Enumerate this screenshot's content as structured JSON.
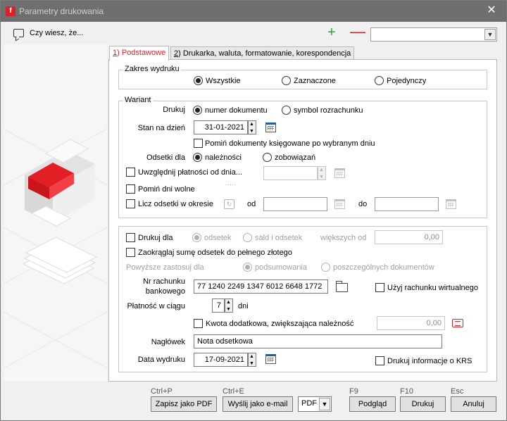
{
  "window": {
    "title": "Parametry drukowania",
    "close": "✕"
  },
  "toolbar": {
    "hint": "Czy wiesz, że...",
    "add": "+",
    "remove": "—",
    "combo_value": ""
  },
  "tabs": [
    {
      "key": "1",
      "label": ") Podstawowe"
    },
    {
      "key": "2",
      "label": ") Drukarka, waluta, formatowanie, korespondencja"
    }
  ],
  "zakres": {
    "title": "Zakres wydruku",
    "options": [
      "Wszystkie",
      "Zaznaczone",
      "Pojedynczy"
    ],
    "selected": "Wszystkie"
  },
  "wariant": {
    "title": "Wariant",
    "drukuj_label": "Drukuj",
    "drukuj_options": [
      "numer dokumentu",
      "symbol rozrachunku"
    ],
    "stan_label": "Stan na dzień",
    "stan_value": "31-01-2021",
    "pomin_ksiegowane": "Pomiń dokumenty księgowane po wybranym dniu",
    "odsetki_label": "Odsetki dla",
    "odsetki_options": [
      "należności",
      "zobowiązań"
    ],
    "uwzglednij": "Uwzględnij płatności od dnia...",
    "uwzglednij_value": "",
    "dots": ".....",
    "pomin_wolne": "Pomiń dni wolne",
    "licz_odsetki": "Licz odsetki w okresie",
    "od_label": "od",
    "do_label": "do",
    "od_value": "",
    "do_value": ""
  },
  "lower": {
    "drukuj_dla": "Drukuj dla",
    "drukuj_dla_options": [
      "odsetek",
      "sald i odsetek"
    ],
    "wiekszych_label": "większych od",
    "wiekszych_value": "0,00",
    "zaokraglaj": "Zaokrąglaj sumę odsetek do pełnego złotego",
    "powyzsze_label": "Powyższe zastosuj dla",
    "powyzsze_options": [
      "podsumowania",
      "poszczególnych dokumentów"
    ],
    "nr_rachunku_line1": "Nr rachunku",
    "nr_rachunku_line2": "bankowego",
    "nr_rachunku_value": "77 1240 2249 1347 6012 6648 1772",
    "uzyj_wirtualnego": "Użyj rachunku wirtualnego",
    "platnosc_label": "Płatność w ciągu",
    "platnosc_value": "7",
    "platnosc_unit": "dni",
    "kwota_dodatkowa": "Kwota dodatkowa, zwiększająca należność",
    "kwota_value": "0,00",
    "naglowek_label": "Nagłówek",
    "naglowek_value": "Nota odsetkowa",
    "data_label": "Data wydruku",
    "data_value": "17-09-2021",
    "krs": "Drukuj informacje o KRS"
  },
  "footer": {
    "pdf_shortcut": "Ctrl+P",
    "pdf_button": "Zapisz jako PDF",
    "email_shortcut": "Ctrl+E",
    "email_button": "Wyślij jako e-mail",
    "format_value": "PDF",
    "preview_shortcut": "F9",
    "preview_button": "Podgląd",
    "print_shortcut": "F10",
    "print_button": "Drukuj",
    "cancel_shortcut": "Esc",
    "cancel_button": "Anuluj"
  },
  "colors": {
    "accent": "#d6222a",
    "titlebar": "#6f6f6f",
    "add": "#2ca52c"
  }
}
